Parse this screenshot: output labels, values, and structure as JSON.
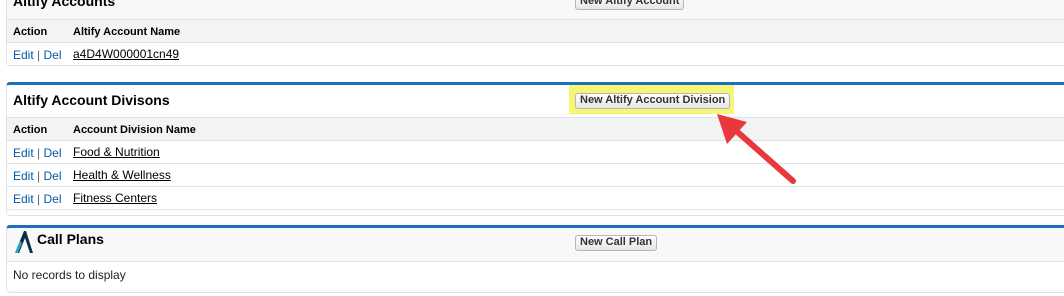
{
  "accounts": {
    "title": "Altify Accounts",
    "new_button": "New Altify Account",
    "columns": [
      "Action",
      "Altify Account Name"
    ],
    "rows": [
      {
        "edit": "Edit",
        "del": "Del",
        "name": "a4D4W000001cn49"
      }
    ]
  },
  "divisions": {
    "title": "Altify Account Divisons",
    "new_button": "New Altify Account Division",
    "columns": [
      "Action",
      "Account Division Name"
    ],
    "rows": [
      {
        "edit": "Edit",
        "del": "Del",
        "name": "Food & Nutrition"
      },
      {
        "edit": "Edit",
        "del": "Del",
        "name": "Health & Wellness"
      },
      {
        "edit": "Edit",
        "del": "Del",
        "name": "Fitness Centers"
      }
    ]
  },
  "call_plans": {
    "title": "Call Plans",
    "new_button": "New Call Plan",
    "empty_text": "No records to display",
    "logo_icon": "altify-logo-icon"
  },
  "annotation": {
    "highlight_color": "#f6f35e",
    "arrow_color": "#e8383d"
  },
  "separator": "|",
  "accent_color": "#1f6fba"
}
